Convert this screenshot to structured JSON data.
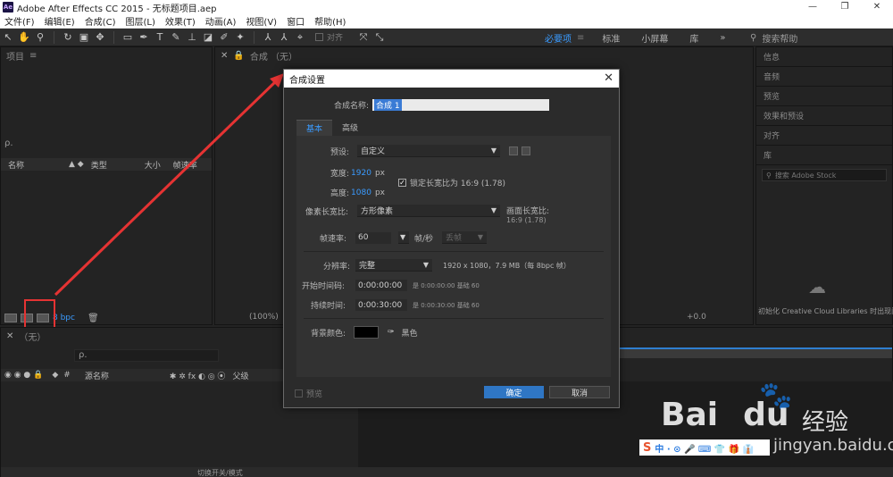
{
  "window": {
    "title": "Adobe After Effects CC 2015 - 无标题项目.aep",
    "logo_text": "Ae",
    "minimize": "—",
    "maximize": "❐",
    "close": "✕"
  },
  "menu": [
    "文件(F)",
    "编辑(E)",
    "合成(C)",
    "图层(L)",
    "效果(T)",
    "动画(A)",
    "视图(V)",
    "窗口",
    "帮助(H)"
  ],
  "toolbar": {
    "align_label": "对齐",
    "workspaces": [
      "必要项",
      "标准",
      "小屏幕",
      "库"
    ],
    "more": "»",
    "search_help": "搜索帮助"
  },
  "project_panel": {
    "tab": "项目",
    "search_placeholder": "ρ.",
    "columns": [
      "名称",
      "类型",
      "大小",
      "帧速率"
    ],
    "bpc": "8 bpc"
  },
  "comp_panel": {
    "tab": "合成 （无）",
    "zoom": "(100%)",
    "offset": "+0.0"
  },
  "right_panel": {
    "items": [
      "信息",
      "音频",
      "预览",
      "效果和预设",
      "对齐"
    ],
    "library_tab": "库",
    "stock_search": "搜索 Adobe Stock",
    "cc_message": "初始化 Creative Cloud Libraries 时出现问"
  },
  "timeline": {
    "tab": "（无）",
    "search_placeholder": "ρ.",
    "hash": "#",
    "source_name": "源名称",
    "parent": "父级",
    "switch_mode": "切换开关/模式"
  },
  "dialog": {
    "title": "合成设置",
    "name_label": "合成名称:",
    "name_value": "合成 1",
    "tabs": [
      "基本",
      "高级"
    ],
    "preset_label": "预设:",
    "preset_value": "自定义",
    "width_label": "宽度:",
    "width_value": "1920",
    "height_label": "高度:",
    "height_value": "1080",
    "px": "px",
    "lock_ratio": "锁定长宽比为 16:9 (1.78)",
    "par_label": "像素长宽比:",
    "par_value": "方形像素",
    "frame_aspect_label": "画面长宽比:",
    "frame_aspect_value": "16:9 (1.78)",
    "fps_label": "帧速率:",
    "fps_value": "60",
    "fps_unit": "帧/秒",
    "drop_frame": "丢帧",
    "resolution_label": "分辨率:",
    "resolution_value": "完整",
    "resolution_info": "1920 x 1080，7.9 MB（每 8bpc 帧）",
    "start_tc_label": "开始时间码:",
    "start_tc_value": "0:00:00:00",
    "start_tc_info": "是 0:00:00:00  基础 60",
    "duration_label": "持续时间:",
    "duration_value": "0:00:30:00",
    "duration_info": "是 0:00:30:00  基础 60",
    "bg_label": "背景颜色:",
    "bg_color_name": "黑色",
    "bg_color": "#000000",
    "preview": "预览",
    "ok": "确定",
    "cancel": "取消"
  },
  "watermark": {
    "brand": "Bai",
    "brand2": "du",
    "jingyan": "经验",
    "url": "jingyan.baidu.com",
    "strip": "中 · ⊙ 🎤 ⌨ 👕 🎁 👔"
  },
  "colors": {
    "accent": "#3a9bff",
    "annotation_red": "#e53333",
    "ok_button": "#2f76c4"
  }
}
